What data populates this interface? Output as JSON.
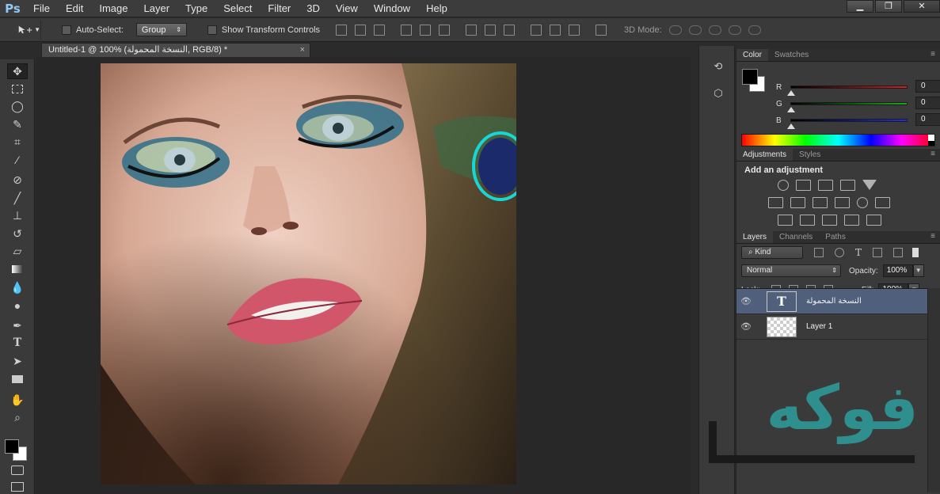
{
  "app": {
    "logo": "Ps",
    "menu": [
      "File",
      "Edit",
      "Image",
      "Layer",
      "Type",
      "Select",
      "Filter",
      "3D",
      "View",
      "Window",
      "Help"
    ],
    "window_controls": [
      "▁",
      "❐",
      "✕"
    ]
  },
  "options_bar": {
    "auto_select_label": "Auto-Select:",
    "auto_select_value": "Group",
    "show_transform_label": "Show Transform Controls",
    "mode_3d_label": "3D Mode:"
  },
  "document": {
    "tab_title": "Untitled-1 @ 100% (النسخة المحمولة, RGB/8) *",
    "tab_close": "×"
  },
  "color_panel": {
    "tabs": [
      "Color",
      "Swatches"
    ],
    "fg": "#000000",
    "bg": "#ffffff",
    "channels": [
      {
        "label": "R",
        "value": "0",
        "color": "#d81f1f"
      },
      {
        "label": "G",
        "value": "0",
        "color": "#1fa51f"
      },
      {
        "label": "B",
        "value": "0",
        "color": "#1f2fd8"
      }
    ]
  },
  "adjustments_panel": {
    "tabs": [
      "Adjustments",
      "Styles"
    ],
    "title": "Add an adjustment"
  },
  "layers_panel": {
    "tabs": [
      "Layers",
      "Channels",
      "Paths"
    ],
    "kind_label": "Kind",
    "blend_mode": "Normal",
    "opacity_label": "Opacity:",
    "opacity_value": "100%",
    "lock_label": "Lock:",
    "fill_label": "Fill:",
    "fill_value": "100%",
    "layers": [
      {
        "name": "النسخة المحمولة",
        "type": "text",
        "thumb_label": "T",
        "selected": true
      },
      {
        "name": "Layer 1",
        "type": "pixel",
        "selected": false
      }
    ]
  },
  "watermark": {
    "text": "فوكه",
    "color": "#2f8f8f"
  }
}
